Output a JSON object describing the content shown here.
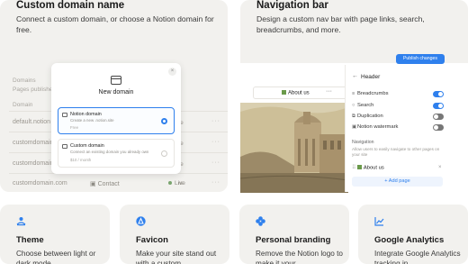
{
  "colors": {
    "card_bg": "#f2f1ee",
    "accent_blue": "#2f80ed",
    "icon_blue": "#2f80ed"
  },
  "custom_domain_card": {
    "title": "Custom domain name",
    "description": "Connect a custom domain, or choose a Notion domain for free.",
    "bg_header": "Domains",
    "bg_subheader": "Pages published to your domains",
    "bg_column": "Domain",
    "bg_rows": [
      {
        "domain": "default.notion",
        "right": "re"
      },
      {
        "domain": "customdomain",
        "right": "re"
      },
      {
        "domain": "customdomain",
        "right": "re"
      },
      {
        "domain": "customdomain",
        "right": "re"
      }
    ],
    "bg_last_row": {
      "domain": "customdomain.com",
      "page": "Contact",
      "status": "Live"
    },
    "modal": {
      "title": "New domain",
      "options": [
        {
          "label": "Notion domain",
          "subtitle": "Create a new .notion.site",
          "price": "Free"
        },
        {
          "label": "Custom domain",
          "subtitle": "Connect an existing domain you already own",
          "price": "$10 / month"
        }
      ]
    }
  },
  "nav_bar_card": {
    "title": "Navigation bar",
    "description": "Design a custom nav bar with page links, search, breadcrumbs, and more.",
    "publish_button": "Publish changes",
    "page_link": "About us",
    "panel": {
      "title": "Header",
      "toggles": [
        {
          "label": "Breadcrumbs",
          "on": true
        },
        {
          "label": "Search",
          "on": true
        },
        {
          "label": "Duplication",
          "on": false
        },
        {
          "label": "Notion watermark",
          "on": false
        }
      ],
      "section_label": "Navigation",
      "section_desc": "Allow users to easily navigate to other pages on your site",
      "nav_item": "About us",
      "add_page": "+ Add page"
    }
  },
  "feature_cards": [
    {
      "icon": "theme-icon",
      "title": "Theme",
      "description": "Choose between light or dark mode"
    },
    {
      "icon": "favicon-icon",
      "title": "Favicon",
      "description": "Make your site stand out with a custom"
    },
    {
      "icon": "branding-icon",
      "title": "Personal branding",
      "description": "Remove the Notion logo to make it your"
    },
    {
      "icon": "analytics-icon",
      "title": "Google Analytics",
      "description": "Integrate Google Analytics tracking in"
    }
  ]
}
